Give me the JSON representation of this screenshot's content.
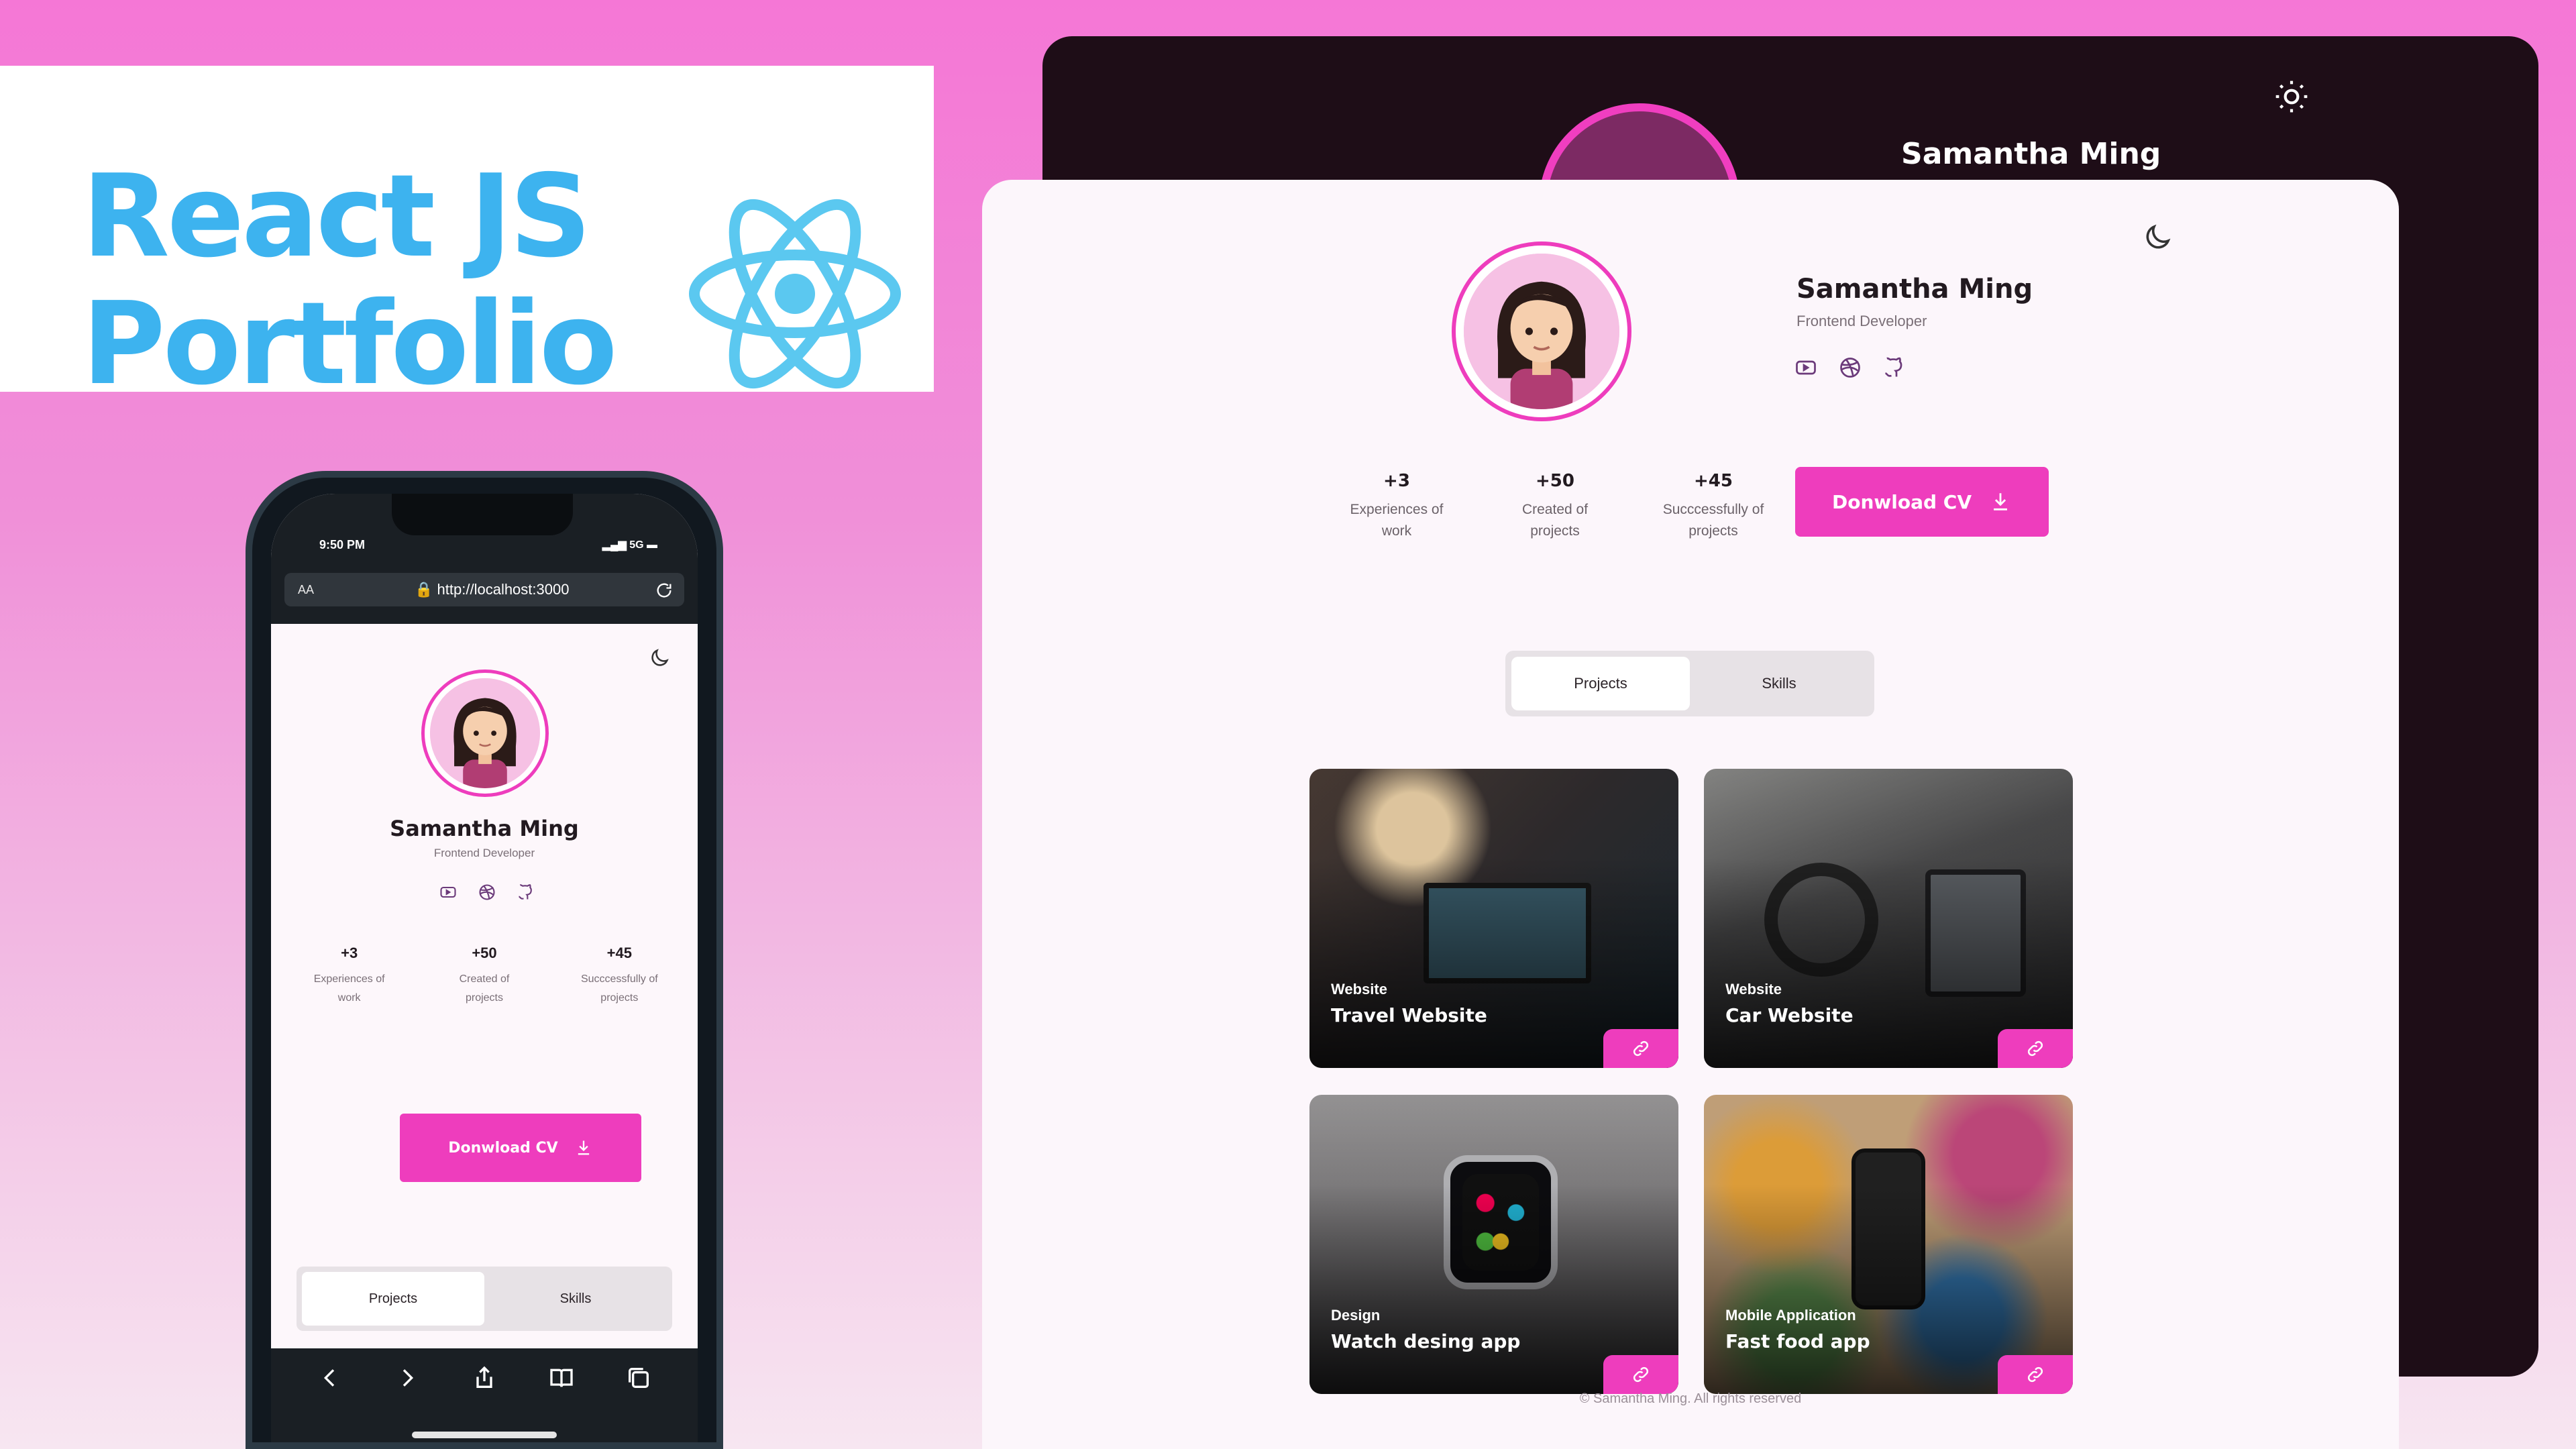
{
  "banner": {
    "line1": "React JS",
    "line2": "Portfolio"
  },
  "dark_preview": {
    "name": "Samantha Ming"
  },
  "profile": {
    "name": "Samantha Ming",
    "role": "Frontend Developer",
    "socials": [
      "youtube-icon",
      "dribbble-icon",
      "github-icon"
    ]
  },
  "stats": [
    {
      "value": "+3",
      "label_1": "Experiences of",
      "label_2": "work"
    },
    {
      "value": "+50",
      "label_1": "Created of",
      "label_2": "projects"
    },
    {
      "value": "+45",
      "label_1": "Succcessfully of",
      "label_2": "projects"
    }
  ],
  "cv_button": "Donwload CV",
  "tabs": {
    "projects": "Projects",
    "skills": "Skills",
    "active": "Projects"
  },
  "projects": [
    {
      "category": "Website",
      "title": "Travel Website"
    },
    {
      "category": "Website",
      "title": "Car Website"
    },
    {
      "category": "Design",
      "title": "Watch desing app"
    },
    {
      "category": "Mobile Application",
      "title": "Fast food app"
    }
  ],
  "footer": "© Samantha Ming. All rights reserved",
  "phone": {
    "time": "9:50 PM",
    "signal": "5G",
    "url_prefix": "AA",
    "url": "http://localhost:3000"
  },
  "colors": {
    "accent": "#ee3dbd",
    "banner_text": "#3db3ef",
    "dark_bg": "#1e0d17",
    "light_bg": "#fcf6fb"
  }
}
